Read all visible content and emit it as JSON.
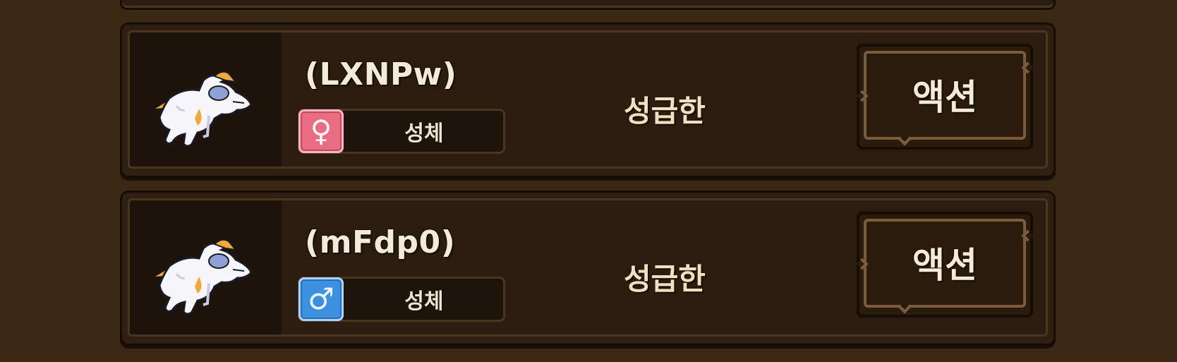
{
  "cards": [
    {
      "name": "(LXNPw)",
      "gender": "female",
      "gender_symbol": "♀",
      "gender_color": "#e86d82",
      "stage": "성체",
      "trait": "성급한",
      "action_label": "액션",
      "portrait_icon": "white-dragon-sprite-icon"
    },
    {
      "name": "(mFdp0)",
      "gender": "male",
      "gender_symbol": "♂",
      "gender_color": "#3d8fe0",
      "stage": "성체",
      "trait": "성급한",
      "action_label": "액션",
      "portrait_icon": "white-dragon-sprite-icon"
    }
  ],
  "colors": {
    "background": "#3a2814",
    "card": "#2e1f11",
    "border_light": "#7b5c3c",
    "text": "#f4ead8"
  }
}
